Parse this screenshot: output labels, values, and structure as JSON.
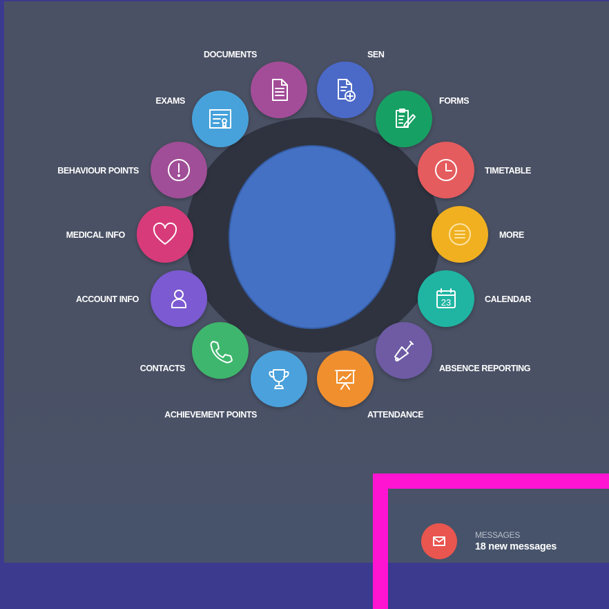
{
  "menu": [
    {
      "label": "DOCUMENTS",
      "icon": "document-icon",
      "color": "#a34d98"
    },
    {
      "label": "SEN",
      "icon": "document-plus-icon",
      "color": "#4b69c7"
    },
    {
      "label": "FORMS",
      "icon": "form-edit-icon",
      "color": "#17a063"
    },
    {
      "label": "TIMETABLE",
      "icon": "clock-icon",
      "color": "#e55c5e"
    },
    {
      "label": "MORE",
      "icon": "list-icon",
      "color": "#f0b020"
    },
    {
      "label": "CALENDAR",
      "icon": "calendar-icon",
      "color": "#1fb5a2",
      "calendar_day": "23"
    },
    {
      "label": "ABSENCE REPORTING",
      "icon": "bell-icon",
      "color": "#6e5ba4"
    },
    {
      "label": "ATTENDANCE",
      "icon": "presentation-chart-icon",
      "color": "#f08f2e"
    },
    {
      "label": "ACHIEVEMENT POINTS",
      "icon": "trophy-icon",
      "color": "#4aa1db"
    },
    {
      "label": "CONTACTS",
      "icon": "phone-icon",
      "color": "#3fb66d"
    },
    {
      "label": "ACCOUNT INFO",
      "icon": "user-icon",
      "color": "#7c5ad2"
    },
    {
      "label": "MEDICAL INFO",
      "icon": "heart-icon",
      "color": "#d83b7a"
    },
    {
      "label": "BEHAVIOUR POINTS",
      "icon": "exclamation-icon",
      "color": "#a04e97"
    },
    {
      "label": "EXAMS",
      "icon": "certificate-icon",
      "color": "#47a2db"
    }
  ],
  "messages": {
    "title": "MESSAGES",
    "count_text": "18 new messages",
    "icon": "envelope-icon",
    "color": "#e9554f"
  },
  "colors": {
    "page_background": "#3c3a8e",
    "panel_background": "#4b5164",
    "footer_background": "#46536a",
    "ring": "#2f3340",
    "center_disc": "#4471c4",
    "highlight_box": "#ff14d2"
  }
}
